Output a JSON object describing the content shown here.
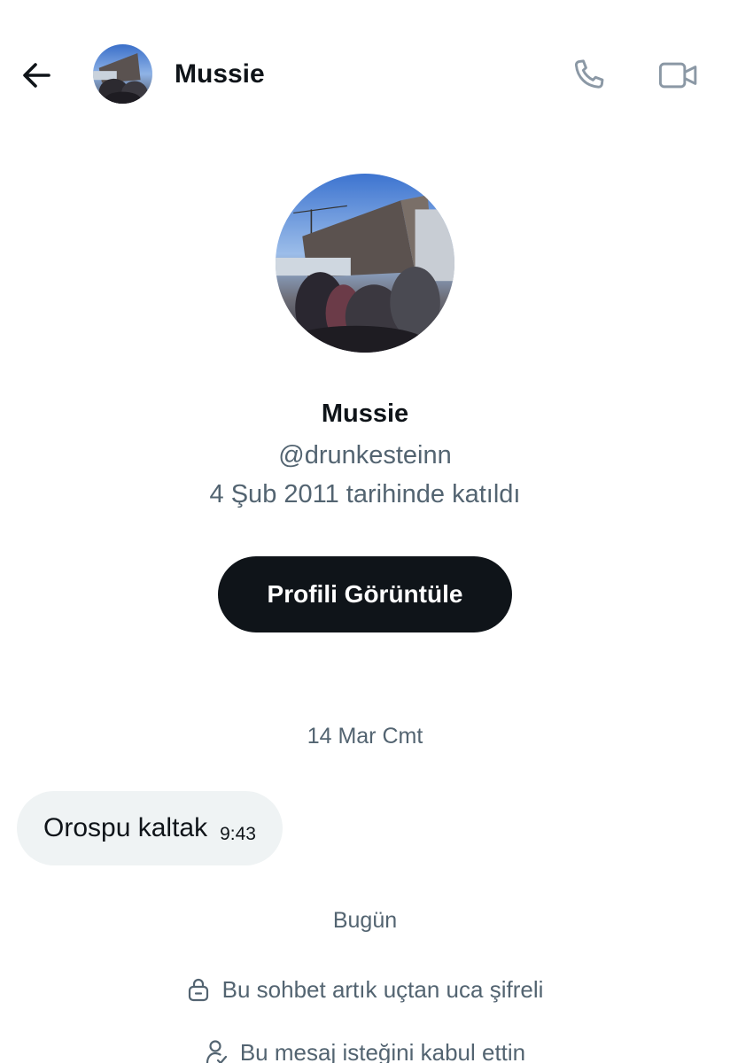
{
  "header": {
    "back_icon": "arrow-left-icon",
    "name": "Mussie",
    "call_icon": "phone-icon",
    "video_icon": "video-camera-icon"
  },
  "profile": {
    "name": "Mussie",
    "handle": "@drunkesteinn",
    "joined": "4 Şub 2011 tarihinde katıldı",
    "view_profile_label": "Profili Görüntüle"
  },
  "conversation": {
    "date_separator_1": "14 Mar Cmt",
    "message": {
      "text": "Orospu kaltak",
      "time": "9:43"
    },
    "date_separator_2": "Bugün",
    "encryption_note": "Bu sohbet artık uçtan uca şifreli",
    "encryption_icon": "lock-icon",
    "request_note": "Bu mesaj isteğini kabul ettin",
    "request_icon": "person-check-icon"
  },
  "colors": {
    "primary_text": "#0f1419",
    "secondary_text": "#536471",
    "bubble_bg": "#eff3f4",
    "button_bg": "#0f1419",
    "button_text": "#ffffff"
  }
}
